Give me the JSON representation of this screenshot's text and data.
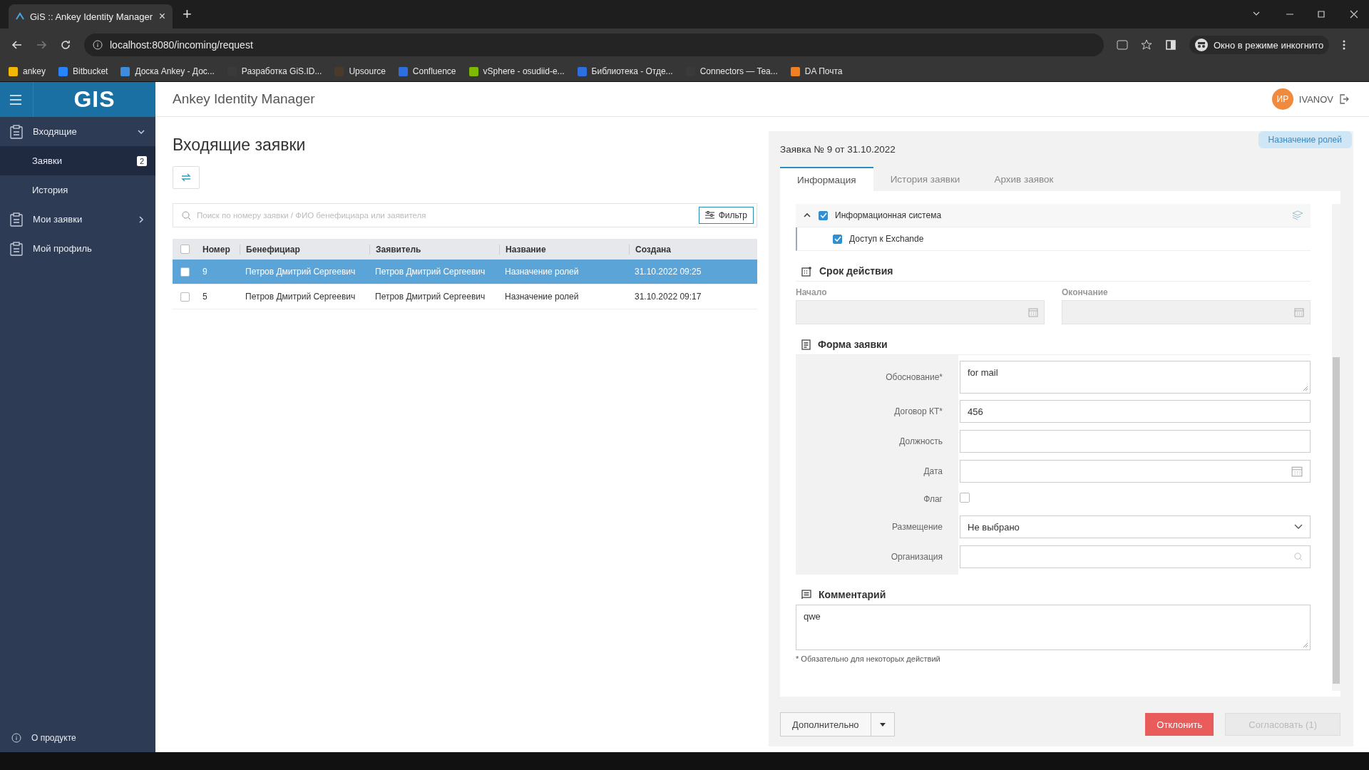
{
  "browser": {
    "tab_title": "GiS :: Ankey Identity Manager",
    "tab_close": "×",
    "new_tab": "+",
    "url": "localhost:8080/incoming/request",
    "incognito": "Окно в режиме инкогнито",
    "bookmarks": [
      {
        "label": "ankey",
        "color": "#f2b705"
      },
      {
        "label": "Bitbucket",
        "color": "#2684ff"
      },
      {
        "label": "Доска Ankey - Дос...",
        "color": "#3f8be0"
      },
      {
        "label": "Разработка GiS.ID...",
        "color": "#3a3a3a"
      },
      {
        "label": "Upsource",
        "color": "#4a3a2a"
      },
      {
        "label": "Confluence",
        "color": "#2d6ee0"
      },
      {
        "label": "vSphere - osudiid-e...",
        "color": "#7fb800"
      },
      {
        "label": "Библиотека - Отде...",
        "color": "#2d6ee0"
      },
      {
        "label": "Connectors — Tea...",
        "color": "#3a3a3a"
      },
      {
        "label": "DA Почта",
        "color": "#f08020"
      }
    ]
  },
  "app": {
    "logo": "GIS",
    "title": "Ankey Identity Manager",
    "user": {
      "initials": "ИР",
      "name": "IVANOV"
    }
  },
  "sidebar": {
    "items": [
      {
        "label": "Входящие",
        "expanded": true,
        "children": [
          {
            "label": "Заявки",
            "selected": true,
            "badge": "2"
          },
          {
            "label": "История",
            "selected": false
          }
        ]
      },
      {
        "label": "Мои заявки",
        "expanded": false
      },
      {
        "label": "Мой профиль"
      }
    ],
    "footer": "О продукте"
  },
  "page": {
    "title": "Входящие заявки",
    "search": {
      "placeholder": "Поиск по номеру заявки / ФИО бенефициара или заявителя"
    },
    "filter_button": "Фильтр",
    "table": {
      "select_all": false,
      "columns": [
        "Номер",
        "Бенефициар",
        "Заявитель",
        "Название",
        "Создана"
      ],
      "rows": [
        {
          "selected": true,
          "checked": false,
          "cells": [
            "9",
            "Петров Дмитрий Сергеевич",
            "Петров Дмитрий Сергеевич",
            "Назначение ролей",
            "31.10.2022 09:25"
          ]
        },
        {
          "selected": false,
          "checked": false,
          "cells": [
            "5",
            "Петров Дмитрий Сергеевич",
            "Петров Дмитрий Сергеевич",
            "Назначение ролей",
            "31.10.2022 09:17"
          ]
        }
      ]
    }
  },
  "detail": {
    "title": "Заявка № 9 от 31.10.2022",
    "badge": "Назначение ролей",
    "tabs": [
      {
        "label": "Информация",
        "selected": true
      },
      {
        "label": "История заявки",
        "selected": false
      },
      {
        "label": "Архив заявок",
        "selected": false
      }
    ],
    "resources": [
      {
        "label": "Информационная система",
        "checked": true,
        "expanded": true,
        "children": [
          {
            "label": "Доступ к Exchande",
            "checked": true
          }
        ]
      }
    ],
    "validity": {
      "title": "Срок действия",
      "start_label": "Начало",
      "end_label": "Окончание"
    },
    "form": {
      "title": "Форма заявки",
      "fields": [
        {
          "kind": "textarea",
          "label": "Обоснование*",
          "value": "for mail"
        },
        {
          "kind": "text",
          "label": "Договор КТ*",
          "value": "456"
        },
        {
          "kind": "text",
          "label": "Должность"
        },
        {
          "kind": "date",
          "label": "Дата"
        },
        {
          "kind": "checkbox",
          "label": "Флаг",
          "checked": false
        },
        {
          "kind": "select",
          "label": "Размещение",
          "value": "Не выбрано"
        },
        {
          "kind": "lookup",
          "label": "Организация"
        }
      ]
    },
    "comment": {
      "title": "Комментарий",
      "value": "qwe",
      "note": "* Обязательно для некоторых действий"
    },
    "more_button": "Дополнительно",
    "reject_button": "Отклонить",
    "approve_button": {
      "label": "Согласовать (1)",
      "disabled": true
    }
  }
}
